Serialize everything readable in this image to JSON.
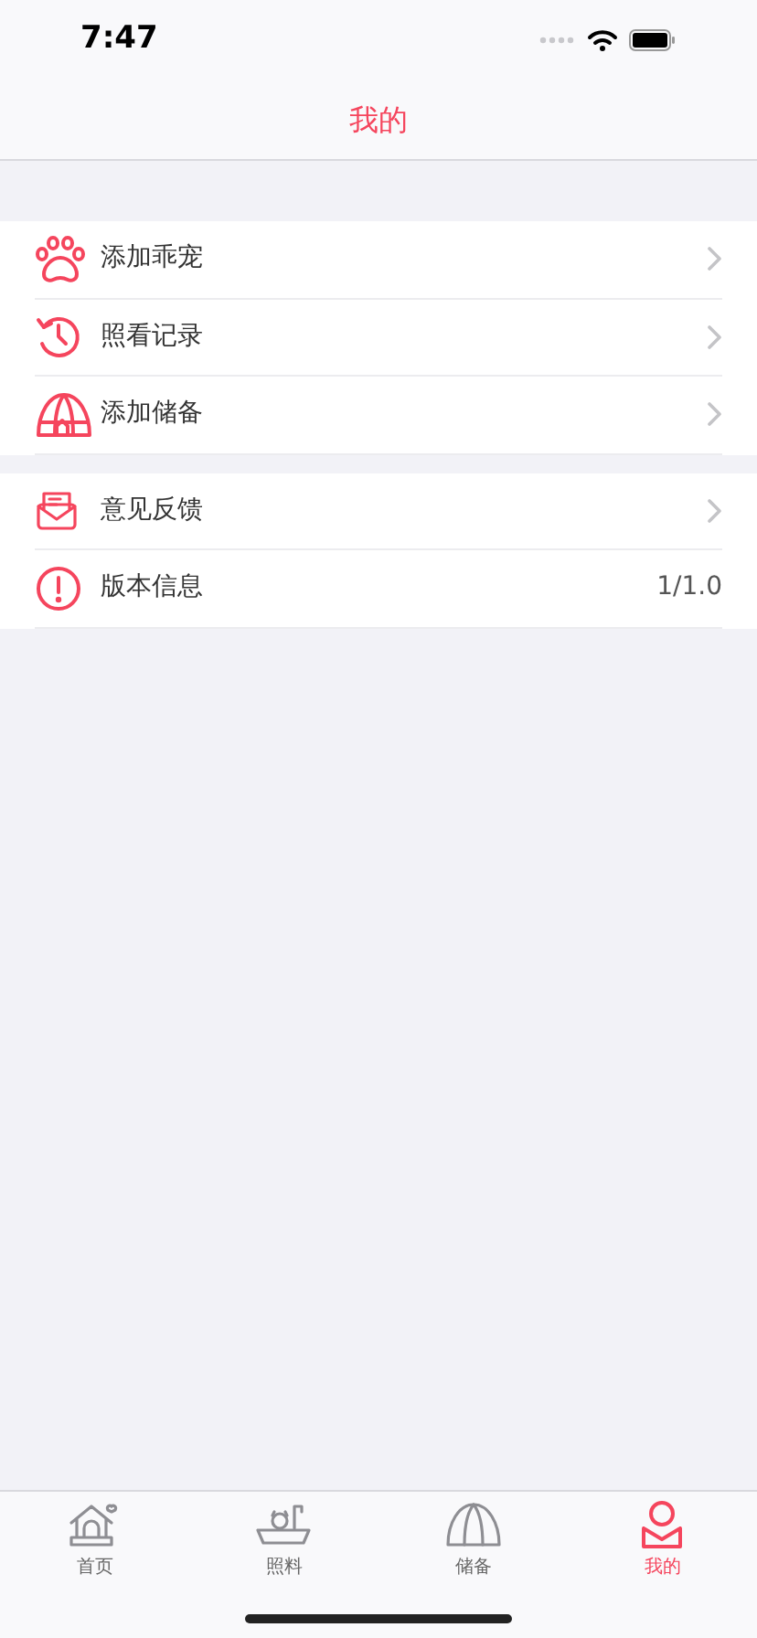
{
  "status_bar": {
    "time": "7:47"
  },
  "nav": {
    "title": "我的"
  },
  "groups": [
    {
      "items": [
        {
          "label": "添加乖宠",
          "kind": "link"
        },
        {
          "label": "照看记录",
          "kind": "link"
        },
        {
          "label": "添加储备",
          "kind": "link"
        }
      ]
    },
    {
      "items": [
        {
          "label": "意见反馈",
          "kind": "link"
        },
        {
          "label": "版本信息",
          "kind": "value",
          "value": "1/1.0"
        }
      ]
    }
  ],
  "tab_bar": [
    {
      "label": "首页",
      "selected": false
    },
    {
      "label": "照料",
      "selected": false
    },
    {
      "label": "储备",
      "selected": false
    },
    {
      "label": "我的",
      "selected": true
    }
  ]
}
